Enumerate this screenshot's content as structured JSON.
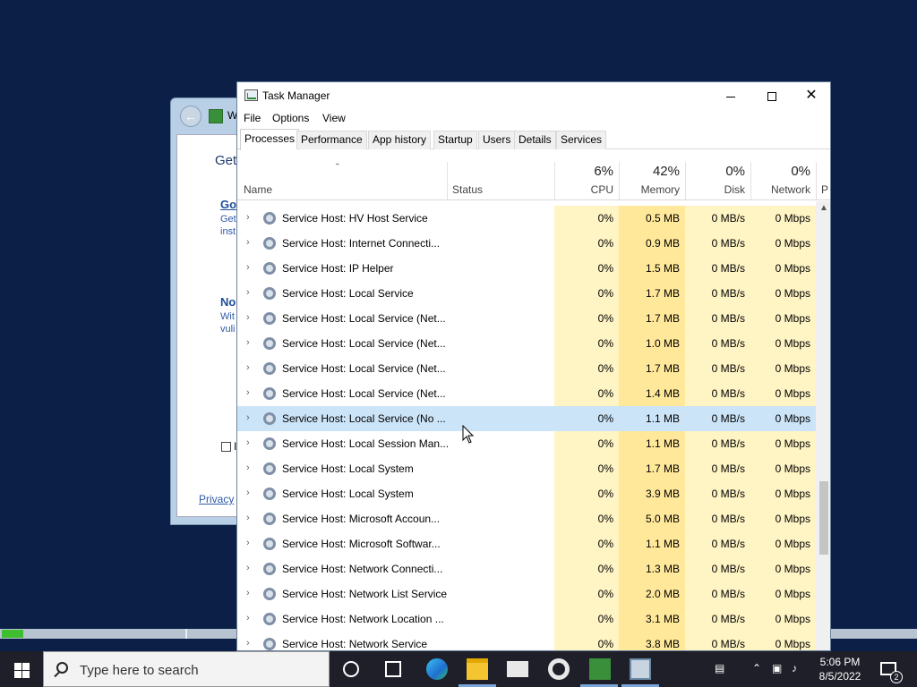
{
  "background_window": {
    "title_fragment": "W",
    "heading_fragment": "Get",
    "option1_title_fragment": "Go",
    "option1_line1": "Get",
    "option1_line2": "inst",
    "option2_title_fragment": "No",
    "option2_line1": "Wit",
    "option2_line2": "vuli",
    "checkbox_label_fragment": "I",
    "privacy_link_fragment": "Privacy"
  },
  "task_manager": {
    "title": "Task Manager",
    "menu": [
      "File",
      "Options",
      "View"
    ],
    "tabs": [
      "Processes",
      "Performance",
      "App history",
      "Startup",
      "Users",
      "Details",
      "Services"
    ],
    "active_tab": "Processes",
    "columns": {
      "name": "Name",
      "status": "Status",
      "cpu_pct": "6%",
      "cpu": "CPU",
      "memory_pct": "42%",
      "memory": "Memory",
      "disk_pct": "0%",
      "disk": "Disk",
      "network_pct": "0%",
      "network": "Network",
      "power_fragment": "P"
    },
    "rows": [
      {
        "name": "Service Host: HV Host Service",
        "cpu": "0%",
        "memory": "0.5 MB",
        "disk": "0 MB/s",
        "network": "0 Mbps"
      },
      {
        "name": "Service Host: Internet Connecti...",
        "cpu": "0%",
        "memory": "0.9 MB",
        "disk": "0 MB/s",
        "network": "0 Mbps"
      },
      {
        "name": "Service Host: IP Helper",
        "cpu": "0%",
        "memory": "1.5 MB",
        "disk": "0 MB/s",
        "network": "0 Mbps"
      },
      {
        "name": "Service Host: Local Service",
        "cpu": "0%",
        "memory": "1.7 MB",
        "disk": "0 MB/s",
        "network": "0 Mbps"
      },
      {
        "name": "Service Host: Local Service (Net...",
        "cpu": "0%",
        "memory": "1.7 MB",
        "disk": "0 MB/s",
        "network": "0 Mbps"
      },
      {
        "name": "Service Host: Local Service (Net...",
        "cpu": "0%",
        "memory": "1.0 MB",
        "disk": "0 MB/s",
        "network": "0 Mbps"
      },
      {
        "name": "Service Host: Local Service (Net...",
        "cpu": "0%",
        "memory": "1.7 MB",
        "disk": "0 MB/s",
        "network": "0 Mbps"
      },
      {
        "name": "Service Host: Local Service (Net...",
        "cpu": "0%",
        "memory": "1.4 MB",
        "disk": "0 MB/s",
        "network": "0 Mbps"
      },
      {
        "name": "Service Host: Local Service (No ...",
        "cpu": "0%",
        "memory": "1.1 MB",
        "disk": "0 MB/s",
        "network": "0 Mbps"
      },
      {
        "name": "Service Host: Local Session Man...",
        "cpu": "0%",
        "memory": "1.1 MB",
        "disk": "0 MB/s",
        "network": "0 Mbps"
      },
      {
        "name": "Service Host: Local System",
        "cpu": "0%",
        "memory": "1.7 MB",
        "disk": "0 MB/s",
        "network": "0 Mbps"
      },
      {
        "name": "Service Host: Local System",
        "cpu": "0%",
        "memory": "3.9 MB",
        "disk": "0 MB/s",
        "network": "0 Mbps"
      },
      {
        "name": "Service Host: Microsoft Accoun...",
        "cpu": "0%",
        "memory": "5.0 MB",
        "disk": "0 MB/s",
        "network": "0 Mbps"
      },
      {
        "name": "Service Host: Microsoft Softwar...",
        "cpu": "0%",
        "memory": "1.1 MB",
        "disk": "0 MB/s",
        "network": "0 Mbps"
      },
      {
        "name": "Service Host: Network Connecti...",
        "cpu": "0%",
        "memory": "1.3 MB",
        "disk": "0 MB/s",
        "network": "0 Mbps"
      },
      {
        "name": "Service Host: Network List Service",
        "cpu": "0%",
        "memory": "2.0 MB",
        "disk": "0 MB/s",
        "network": "0 Mbps"
      },
      {
        "name": "Service Host: Network Location ...",
        "cpu": "0%",
        "memory": "3.1 MB",
        "disk": "0 MB/s",
        "network": "0 Mbps"
      },
      {
        "name": "Service Host: Network Service",
        "cpu": "0%",
        "memory": "3.8 MB",
        "disk": "0 MB/s",
        "network": "0 Mbps"
      }
    ],
    "highlighted_row_index": 8
  },
  "taskbar": {
    "search_placeholder": "Type here to search",
    "time": "5:06 PM",
    "date": "8/5/2022",
    "notification_count": "2",
    "icons": [
      "windows-start-icon",
      "search-icon",
      "cortana-icon",
      "task-view-icon",
      "edge-icon",
      "file-explorer-icon",
      "mail-icon",
      "settings-icon",
      "app-icon",
      "task-manager-icon"
    ]
  },
  "colors": {
    "desktop": "#0b1f47",
    "cpu_column": "#fff4c4",
    "memory_column": "#ffe89a",
    "highlight": "#cce4f7",
    "taskbar": "#1f1f2a"
  }
}
